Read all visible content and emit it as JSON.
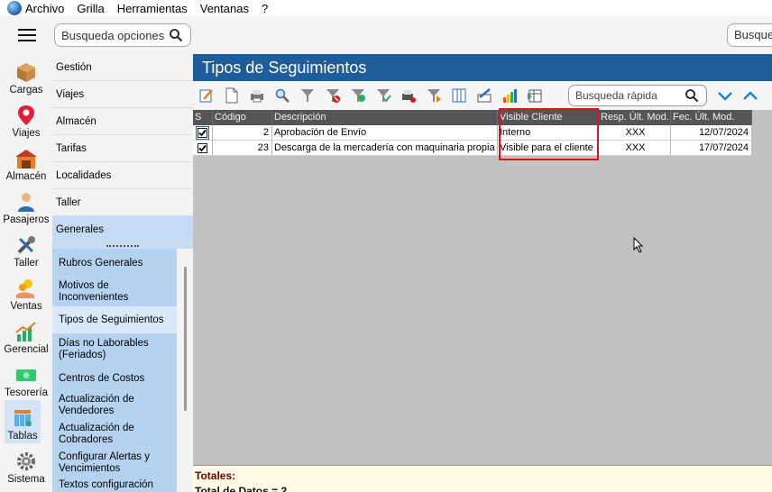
{
  "menubar": {
    "items": [
      "Archivo",
      "Grilla",
      "Herramientas",
      "Ventanas",
      "?"
    ]
  },
  "search": {
    "options_placeholder": "Busqueda opciones",
    "right_placeholder": "Busqueda"
  },
  "rail": {
    "items": [
      {
        "label": "Cargas",
        "icon": "box-icon"
      },
      {
        "label": "Viajes",
        "icon": "map-pin-icon"
      },
      {
        "label": "Almacén",
        "icon": "warehouse-icon"
      },
      {
        "label": "Pasajeros",
        "icon": "person-icon"
      },
      {
        "label": "Taller",
        "icon": "wrench-icon"
      },
      {
        "label": "Ventas",
        "icon": "coins-hand-icon"
      },
      {
        "label": "Gerencial",
        "icon": "chart-icon"
      },
      {
        "label": "Tesorería",
        "icon": "money-icon"
      },
      {
        "label": "Tablas",
        "icon": "table-icon"
      },
      {
        "label": "Sistema",
        "icon": "gear-icon"
      }
    ]
  },
  "nav": {
    "items": [
      "Gestión",
      "Viajes",
      "Almacén",
      "Tarifas",
      "Localidades",
      "Taller",
      "Generales"
    ],
    "sub_items": [
      "Rubros Generales",
      "Motivos de Inconvenientes",
      "Tipos de Seguimientos",
      "Días no Laborables (Feriados)",
      "Centros de Costos",
      "Actualización de Vendedores",
      "Actualización de Cobradores",
      "Configurar Alertas y Vencimientos",
      "Textos configuración"
    ]
  },
  "main": {
    "title": "Tipos de Seguimientos",
    "quick_search_placeholder": "Busqueda rápida",
    "columns": [
      "S",
      "Código",
      "Descripción",
      "Visible Cliente",
      "Resp. Últ. Mod.",
      "Fec. Últ. Mod."
    ],
    "rows": [
      {
        "checked": true,
        "codigo": "2",
        "descripcion": "Aprobación de Envío",
        "visible": "Interno",
        "resp": "XXX",
        "fecha": "12/07/2024"
      },
      {
        "checked": true,
        "codigo": "23",
        "descripcion": "Descarga de la mercadería con maquinaria propia",
        "visible": "Visible para el cliente",
        "resp": "XXX",
        "fecha": "17/07/2024"
      }
    ],
    "totals_label": "Totales:",
    "totals_count": "Total de Datos = 2"
  },
  "colors": {
    "title_bar": "#1e5c9a",
    "nav_selected": "#c4dbf3",
    "subnav_bg": "#b5d2f0",
    "highlight": "#d9141f",
    "grid_header": "#555555"
  }
}
